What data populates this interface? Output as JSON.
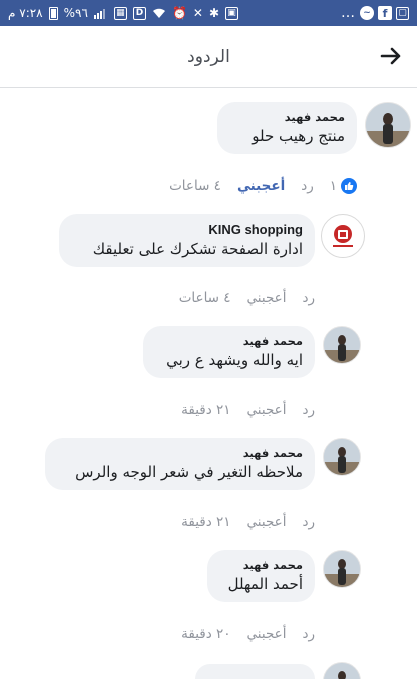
{
  "status_bar": {
    "time": "٧:٢٨ م",
    "battery": "%٩٦",
    "icons": [
      "dots-icon",
      "messenger-icon",
      "facebook-icon",
      "app-icon",
      "battery-icon",
      "signal-icon",
      "signal-icon",
      "image-icon",
      "app-icon",
      "wifi-icon",
      "alarm-icon",
      "mute-icon",
      "bluetooth-icon",
      "image-icon"
    ]
  },
  "header": {
    "title": "الردود",
    "back_icon": "arrow-right-icon"
  },
  "actions": {
    "like": "أعجبني",
    "reply": "رد"
  },
  "comments": [
    {
      "author": "محمد فهيد",
      "text": "منتج رهيب حلو",
      "time": "٤ ساعات",
      "liked": true,
      "reaction_count": "١"
    },
    {
      "author": "KING shopping",
      "text": "ادارة الصفحة تشكرك على تعليقك",
      "time": "٤ ساعات",
      "liked": false
    },
    {
      "author": "محمد فهيد",
      "text": "ايه والله ويشهد ع ربي",
      "time": "٢١ دقيقة",
      "liked": false
    },
    {
      "author": "محمد فهيد",
      "text": "ملاحظه التغير في شعر الوجه والرس",
      "time": "٢١ دقيقة",
      "liked": false
    },
    {
      "author": "محمد فهيد",
      "text": "أحمد المهلل",
      "time": "٢٠ دقيقة",
      "liked": false
    }
  ],
  "colors": {
    "status_bar": "#3b5998",
    "bubble": "#f0f2f5",
    "liked": "#4267b2",
    "meta": "#90949c",
    "logo_red": "#c62828"
  }
}
